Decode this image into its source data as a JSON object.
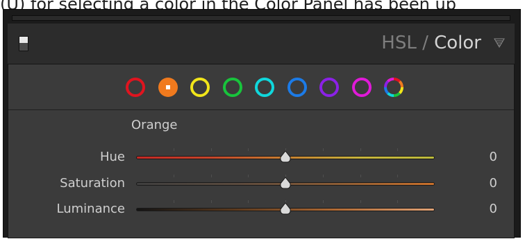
{
  "caption": "(U) for selecting a color in the Color Panel has been up",
  "panel": {
    "title_hsl": "HSL",
    "title_sep": " / ",
    "title_color": "Color",
    "collapse_icon": "triangle-down-icon",
    "toggle_icon": "panel-switch-icon"
  },
  "swatches": [
    {
      "name": "red",
      "color": "#e0141f",
      "selected": false
    },
    {
      "name": "orange",
      "color": "#f07a1e",
      "selected": true
    },
    {
      "name": "yellow",
      "color": "#f1e51a",
      "selected": false
    },
    {
      "name": "green",
      "color": "#18c43c",
      "selected": false
    },
    {
      "name": "aqua",
      "color": "#10d7dc",
      "selected": false
    },
    {
      "name": "blue",
      "color": "#1c7be7",
      "selected": false
    },
    {
      "name": "purple",
      "color": "#8b21e6",
      "selected": false
    },
    {
      "name": "magenta",
      "color": "#e01ad8",
      "selected": false
    },
    {
      "name": "all",
      "color": "multicolor",
      "selected": false
    }
  ],
  "section_title": "Orange",
  "sliders": [
    {
      "label": "Hue",
      "value": "0",
      "position": 0.5,
      "gradient": [
        "#c42824",
        "#c6452a",
        "#c77f30",
        "#c7b43c",
        "#bcbb3c"
      ]
    },
    {
      "label": "Saturation",
      "value": "0",
      "position": 0.5,
      "gradient": [
        "#3f3f3f",
        "#5a4a3e",
        "#8a5c35",
        "#c9702b"
      ]
    },
    {
      "label": "Luminance",
      "value": "0",
      "position": 0.5,
      "gradient": [
        "#141414",
        "#5c3a1e",
        "#b06a34",
        "#e0a276"
      ]
    }
  ]
}
